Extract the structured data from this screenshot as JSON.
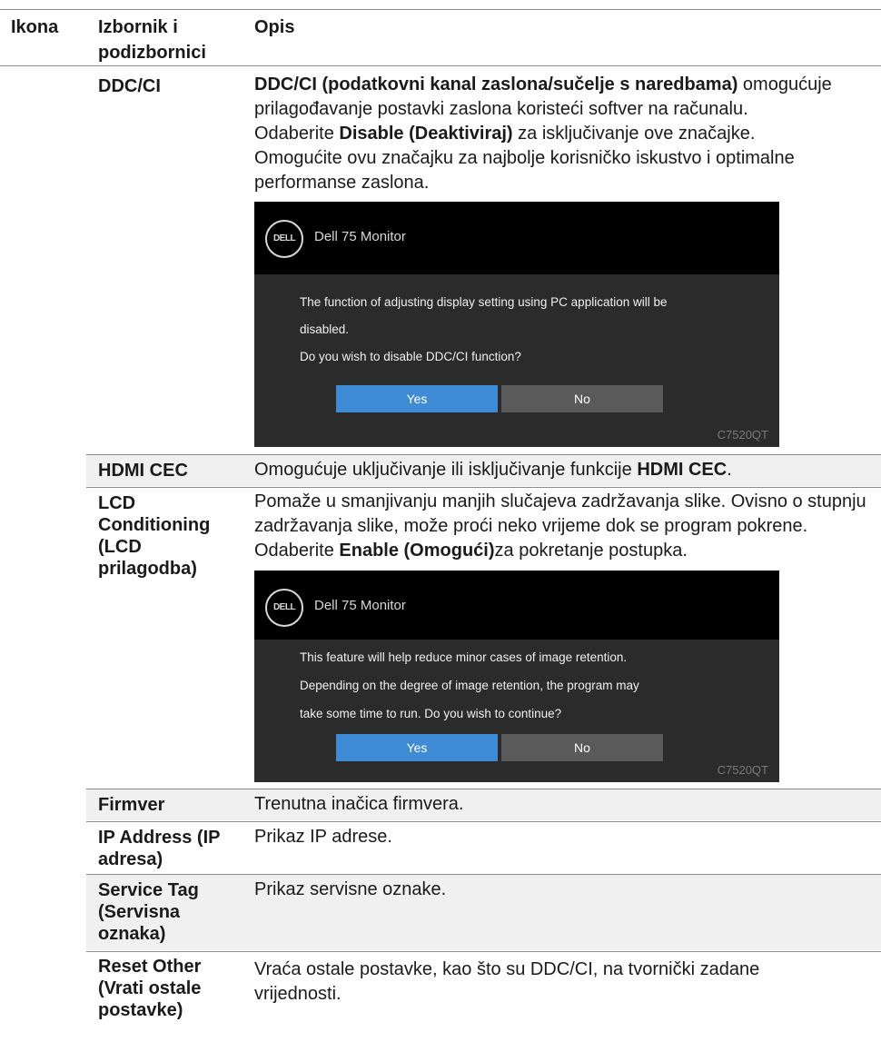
{
  "header": {
    "col_icon": "Ikona",
    "col_menu": "Izbornik i podizbornici",
    "col_desc": "Opis"
  },
  "rows": {
    "ddcci": {
      "menu": "DDC/CI",
      "desc_bold": "DDC/CI (podatkovni kanal zaslona/sučelje s naredbama)",
      "desc_rest": " omogućuje prilagođavanje postavki zaslona koristeći softver na računalu.",
      "line2_pre": "Odaberite ",
      "line2_bold": "Disable (Deaktiviraj)",
      "line2_post": " za isključivanje ove značajke.",
      "line3": "Omogućite ovu značajku za najbolje korisničko iskustvo i optimalne performanse zaslona."
    },
    "hdmicec": {
      "menu": "HDMI CEC",
      "desc_pre": "Omogućuje uključivanje ili isključivanje funkcije ",
      "desc_bold": "HDMI CEC",
      "desc_post": "."
    },
    "lcd": {
      "menu": "LCD Conditioning (LCD prilagodba)",
      "desc_pre": "Pomaže u smanjivanju manjih slučajeva zadržavanja slike. Ovisno o stupnju zadržavanja slike, može proći neko vrijeme dok se program pokrene. Odaberite ",
      "desc_bold": "Enable (Omogući)",
      "desc_post": "za pokretanje postupka."
    },
    "firmware": {
      "menu": "Firmver",
      "desc": "Trenutna inačica firmvera."
    },
    "ip": {
      "menu": "IP Address (IP adresa)",
      "desc": "Prikaz IP adrese."
    },
    "service": {
      "menu": "Service Tag (Servisna oznaka)",
      "desc": "Prikaz servisne oznake."
    },
    "reset": {
      "menu": "Reset Other (Vrati ostale postavke)",
      "desc": "Vraća ostale postavke, kao što su DDC/CI, na tvornički zadane vrijednosti."
    }
  },
  "osd1": {
    "logo": "DELL",
    "title": "Dell 75 Monitor",
    "msg_line1": "The function of adjusting display setting using PC application will be",
    "msg_line2": "disabled.",
    "msg_line3": "Do you wish to disable DDC/CI function?",
    "yes": "Yes",
    "no": "No",
    "model": "C7520QT"
  },
  "osd2": {
    "logo": "DELL",
    "title": "Dell 75 Monitor",
    "msg_line1": "This feature will help reduce minor cases of image retention.",
    "msg_line2": "Depending on the degree of image retention, the program may",
    "msg_line3": "take some time to run. Do you wish to continue?",
    "yes": "Yes",
    "no": "No",
    "model": "C7520QT"
  },
  "colors": {
    "osd_bg": "#2b2b2b",
    "osd_bar": "#000000",
    "yes_button": "#3d8bd4",
    "no_button": "#5a5a5a",
    "row_shade": "#f0f0f0"
  }
}
